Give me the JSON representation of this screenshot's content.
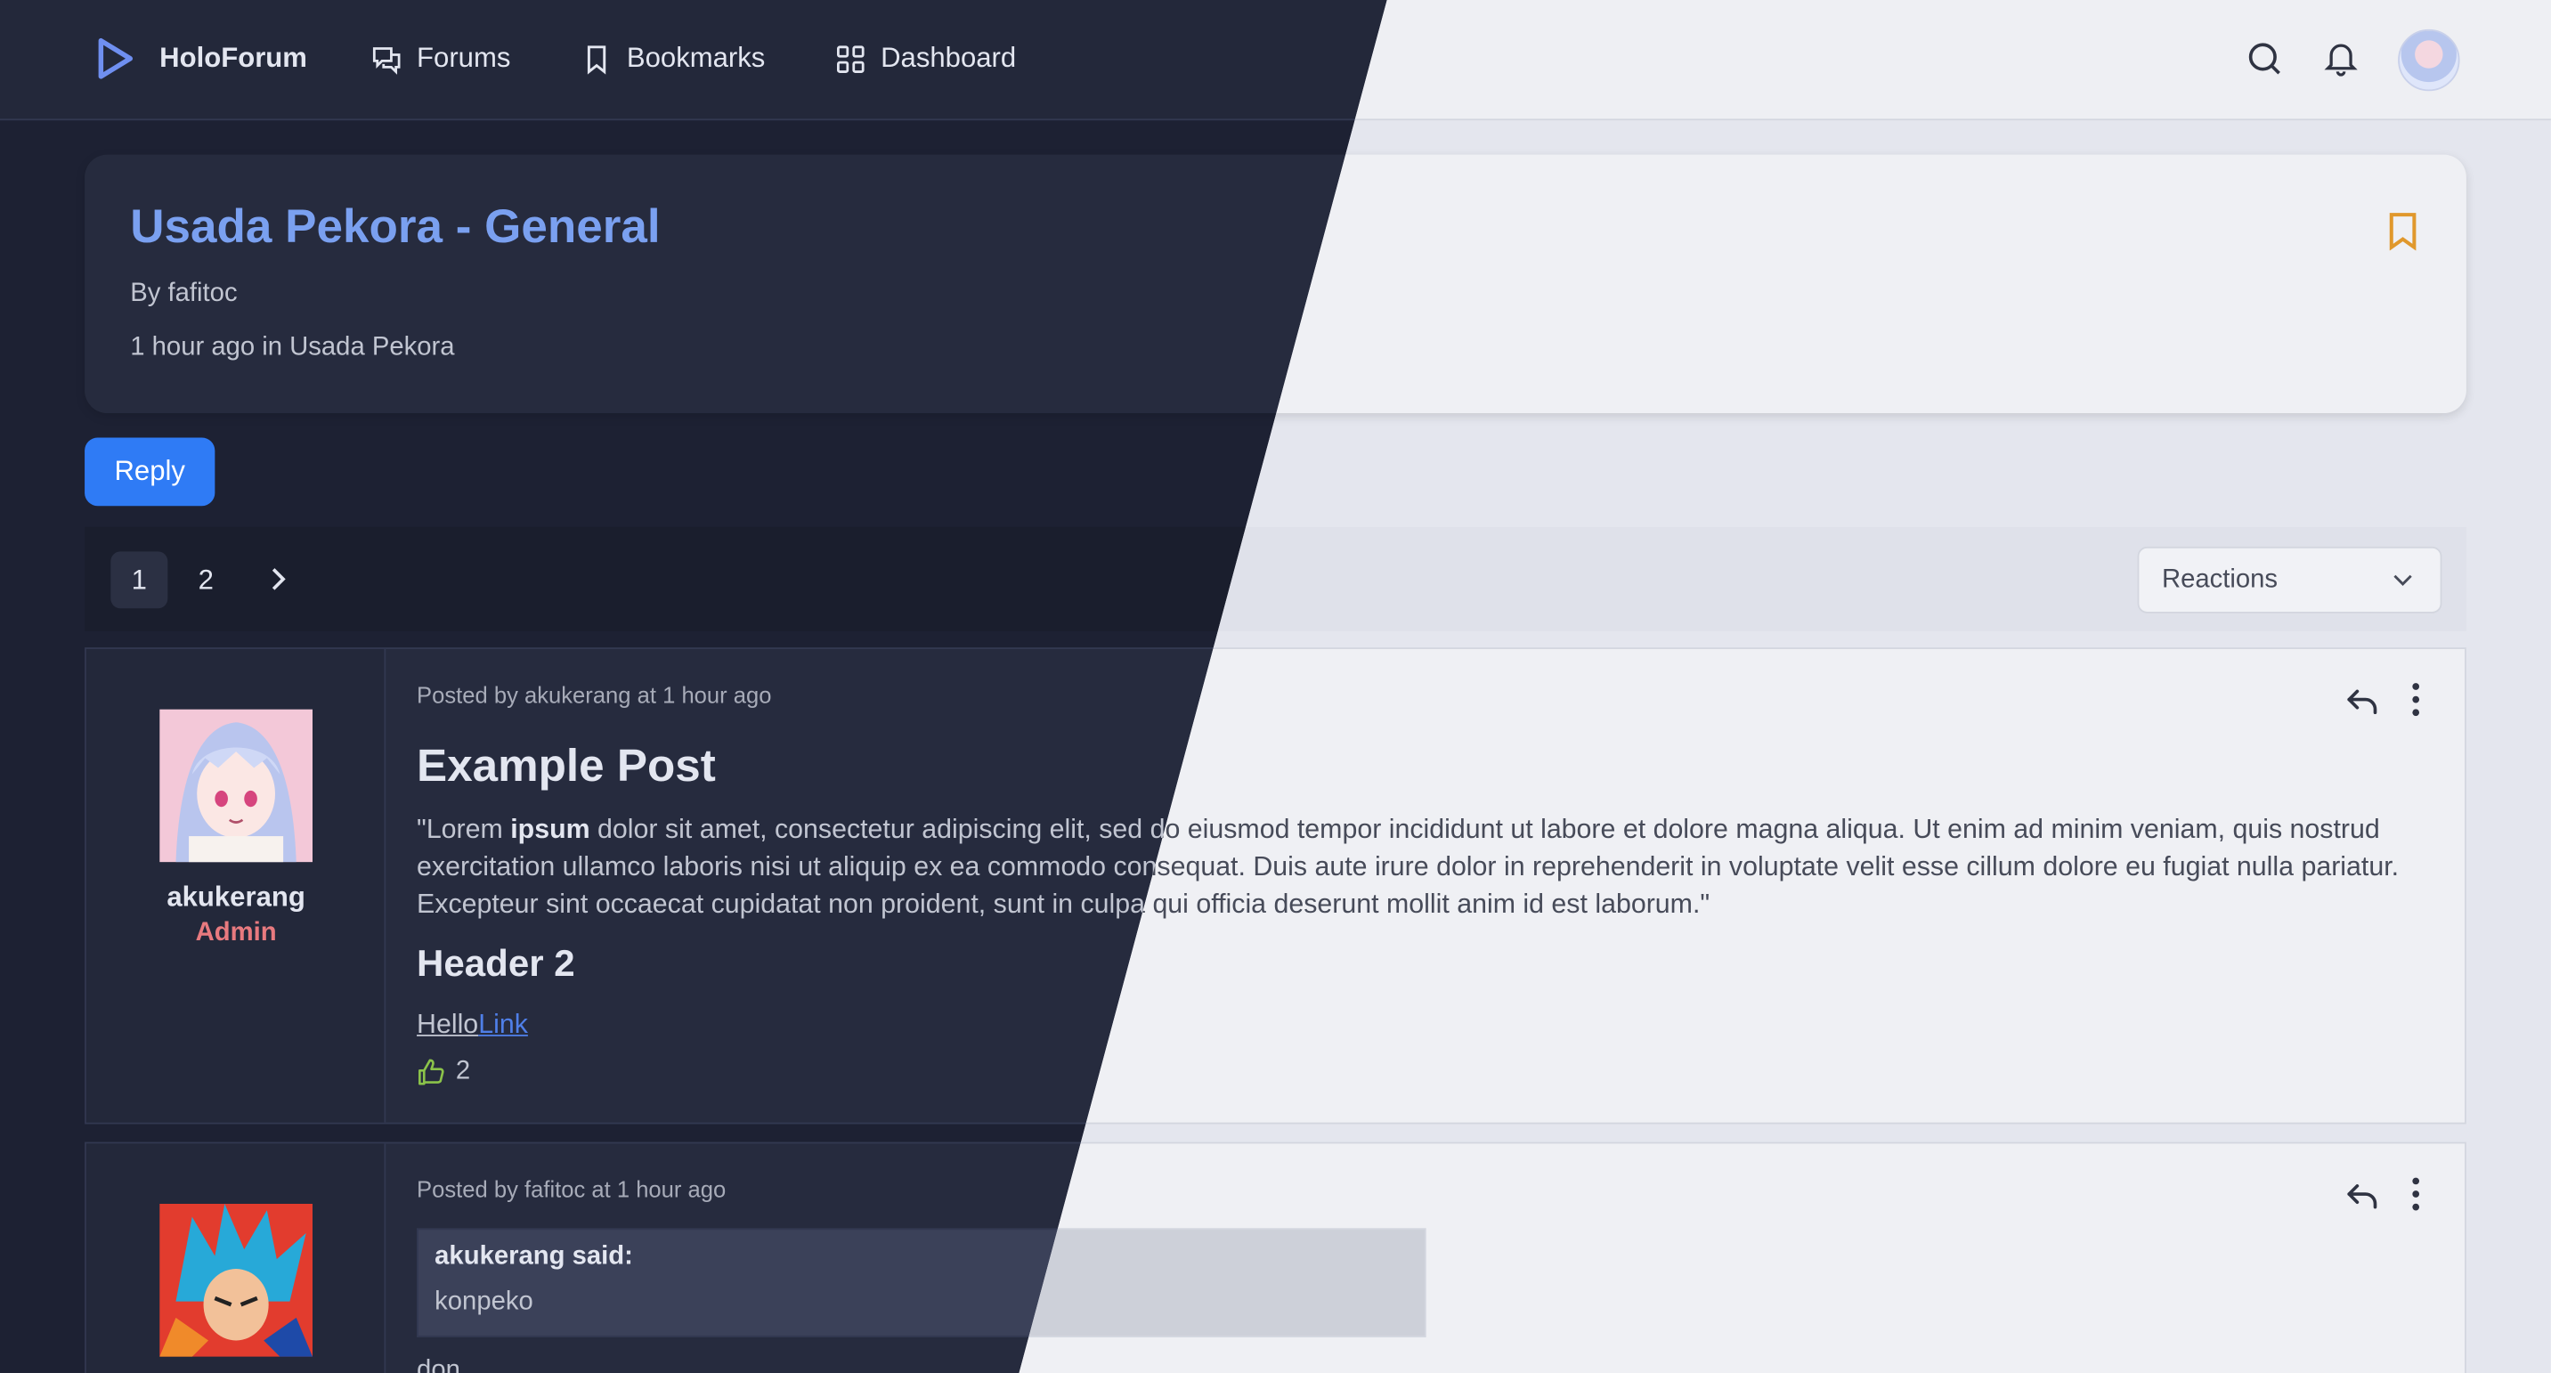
{
  "nav": {
    "brand": "HoloForum",
    "links": [
      {
        "label": "Forums",
        "icon": "forums-icon"
      },
      {
        "label": "Bookmarks",
        "icon": "bookmark-icon"
      },
      {
        "label": "Dashboard",
        "icon": "dashboard-icon"
      }
    ],
    "icons": [
      "search-icon",
      "bell-icon",
      "user-avatar"
    ]
  },
  "thread": {
    "title": "Usada Pekora - General",
    "author": "By fafitoc",
    "meta": "1 hour ago in Usada Pekora"
  },
  "actions": {
    "reply_label": "Reply"
  },
  "pagination": {
    "pages": [
      "1",
      "2"
    ],
    "current": "1"
  },
  "sort": {
    "selected": "Reactions"
  },
  "posts": [
    {
      "username": "akukerang",
      "role": "Admin",
      "meta": "Posted by akukerang at 1 hour ago",
      "title": "Example Post",
      "body_lead": "\"Lorem ",
      "body_bold": "ipsum",
      "body_rest": " dolor sit amet, consectetur adipiscing elit, sed do eiusmod tempor incididunt ut labore et dolore magna aliqua. Ut enim ad minim veniam, quis nostrud exercitation ullamco laboris nisi ut aliquip ex ea commodo consequat. Duis aute irure dolor in reprehenderit in voluptate velit esse cillum dolore eu fugiat nulla pariatur. Excepteur sint occaecat cupidatat non proident, sunt in culpa qui officia deserunt mollit anim id est laborum.\"",
      "header2": "Header 2",
      "link_plain": "Hello",
      "link_blue": "Link",
      "likes": "2"
    },
    {
      "meta": "Posted by fafitoc at 1 hour ago",
      "quote_author": "akukerang said:",
      "quote_text": "konpeko",
      "body_partial": "don"
    }
  ],
  "colors": {
    "accent": "#2f7bf5",
    "title_blue": "#7aa0f0",
    "admin_red": "#e87a7f",
    "bookmark_orange": "#e0982c",
    "like_green": "#8bc34a"
  }
}
